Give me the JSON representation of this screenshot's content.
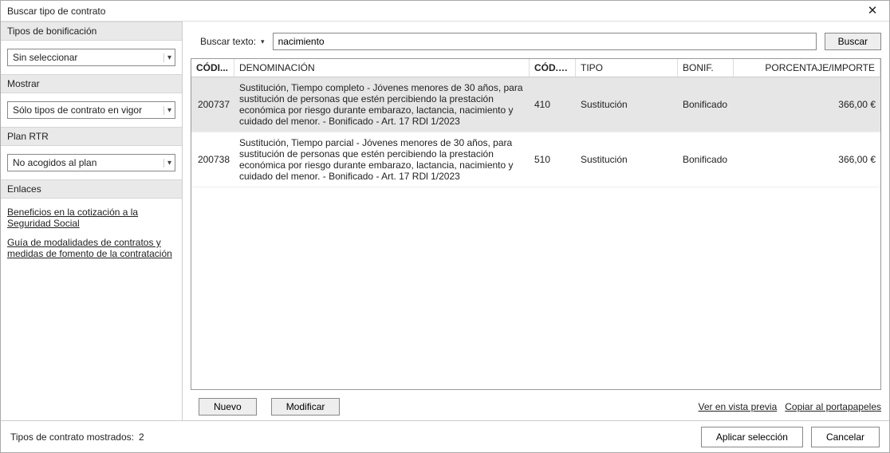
{
  "window": {
    "title": "Buscar tipo de contrato"
  },
  "sidebar": {
    "sections": {
      "bonificacion": {
        "header": "Tipos de bonificación",
        "value": "Sin seleccionar"
      },
      "mostrar": {
        "header": "Mostrar",
        "value": "Sólo tipos de contrato en vigor"
      },
      "plan": {
        "header": "Plan RTR",
        "value": "No acogidos al plan"
      },
      "enlaces": {
        "header": "Enlaces"
      }
    },
    "links": [
      "Beneficios en la cotización a la Seguridad Social",
      "Guía de modalidades de contratos y medidas de fomento de la contratación"
    ]
  },
  "search": {
    "label": "Buscar texto:",
    "value": "nacimiento",
    "button": "Buscar"
  },
  "table": {
    "headers": {
      "codigo": "CÓDI...",
      "denominacion": "DENOMINACIÓN",
      "codo": "CÓD.O...",
      "tipo": "TIPO",
      "bonif": "BONIF.",
      "pct": "PORCENTAJE/IMPORTE"
    },
    "rows": [
      {
        "codigo": "200737",
        "denominacion": "Sustitución, Tiempo completo - Jóvenes menores de 30 años, para sustitución de personas que estén percibiendo la prestación económica por riesgo durante embarazo, lactancia, nacimiento y cuidado del menor. - Bonificado - Art. 17 RDl 1/2023",
        "codo": "410",
        "tipo": "Sustitución",
        "bonif": "Bonificado",
        "pct": "366,00 €",
        "selected": true
      },
      {
        "codigo": "200738",
        "denominacion": "Sustitución, Tiempo parcial - Jóvenes menores de 30 años, para sustitución de personas que estén percibiendo la prestación económica por riesgo durante embarazo, lactancia, nacimiento y cuidado del menor. - Bonificado - Art. 17 RDl 1/2023",
        "codo": "510",
        "tipo": "Sustitución",
        "bonif": "Bonificado",
        "pct": "366,00 €",
        "selected": false
      }
    ]
  },
  "buttons": {
    "nuevo": "Nuevo",
    "modificar": "Modificar",
    "vista_previa": "Ver en vista previa",
    "copiar": "Copiar al portapapeles",
    "aplicar": "Aplicar selección",
    "cancelar": "Cancelar"
  },
  "status": {
    "label": "Tipos de contrato mostrados:",
    "count": "2"
  }
}
